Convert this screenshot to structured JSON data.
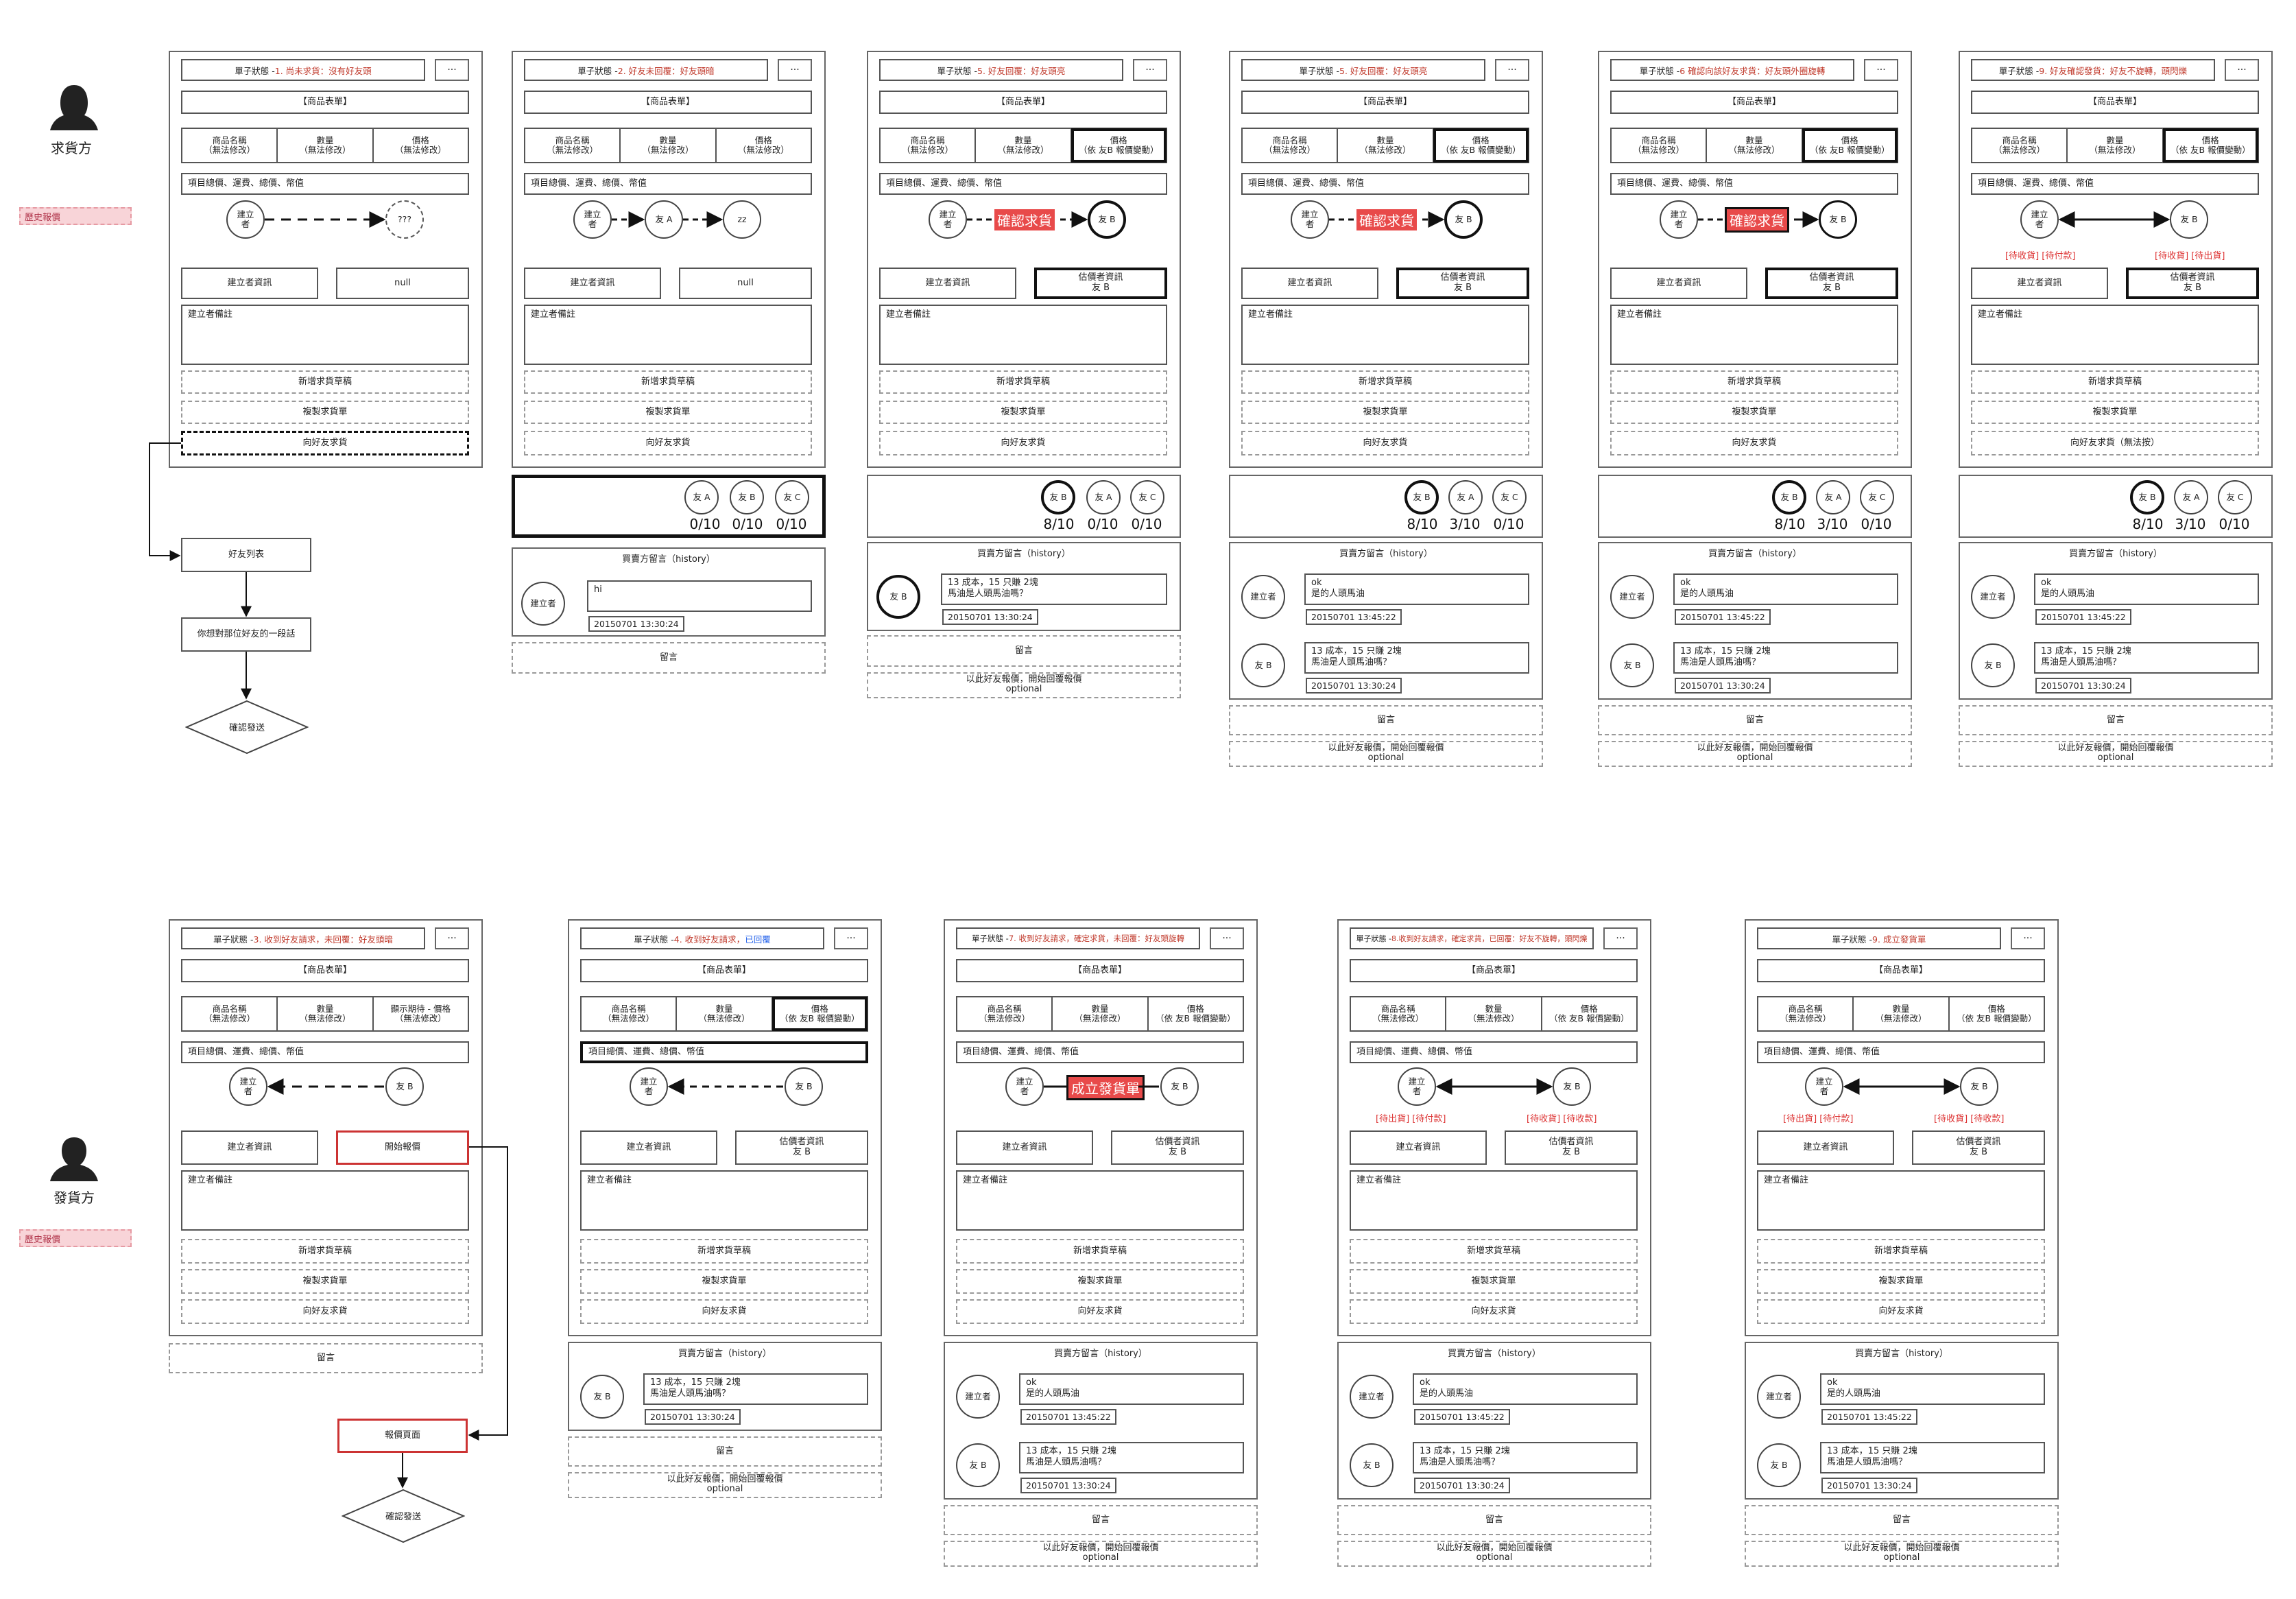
{
  "personas": {
    "requester": {
      "label": "求貨方",
      "history": "歷史報價"
    },
    "supplier": {
      "label": "發貨方",
      "history": "歷史報價"
    }
  },
  "common": {
    "status_prefix": "單子狀態 - ",
    "more": "···",
    "product_form": "【商品表單】",
    "product_name": "商品名稱\n（無法修改）",
    "quantity": "數量\n（無法修改）",
    "price_fixed": "價格\n（無法修改）",
    "price_by_b": "價格\n（依 友B 報價變動）",
    "price_expect": "顯示期待 - 價格\n（無法修改）",
    "items_total": "項目總價、運費、總價、幣值",
    "creator_short": "建立\n者",
    "creator": "建立者",
    "friend_a": "友 A",
    "friend_b": "友 B",
    "friend_c": "友 C",
    "unknown": "???",
    "zz": "zz",
    "creator_info": "建立者資訊",
    "null": "null",
    "estimator_info": "估價者資訊\n友 B",
    "creator_note": "建立者備註",
    "new_draft": "新增求貨草稿",
    "copy_order": "複製求貨單",
    "ask_friend": "向好友求貨",
    "ask_friend_disabled": "向好友求貨（無法按）",
    "start_quote": "開始報價",
    "comment": "留言",
    "history_title": "買賣方留言（history）",
    "reply_base": "以此好友報價，開始回覆報價",
    "optional": "optional",
    "confirm_request": "確認求貨",
    "establish_order": "成立發貨單",
    "pending_receipt": "[待收貨] [待付款]",
    "pending_receipt_r": "[待收貨] [待出貨]",
    "pending_ship": "[待出貨] [待付款]",
    "pending_ship_r": "[待收貨] [待收款]",
    "msg_hi": "hi",
    "msg_ok": "ok\n是的人頭馬油",
    "msg_cost": "13 成本，15 只賺 2塊\n馬油是人頭馬油嗎？",
    "ts1": "20150701 13:30:24",
    "ts2": "20150701 13:45:22",
    "score_0": "0/10",
    "score_8": "8/10",
    "score_3": "3/10"
  },
  "statuses": {
    "r1": "1. 尚未求貨：沒有好友頭",
    "r2": "2. 好友未回覆：好友頭暗",
    "r3": "5. 好友回覆：好友頭亮",
    "r4": "5. 好友回覆：好友頭亮",
    "r5": "6 確認向該好友求貨：好友頭外圈旋轉",
    "r6": "9. 好友確認發貨：好友不旋轉，頭閃爍",
    "s1": "3. 收到好友請求，未回覆：好友頭暗",
    "s2a": "4. 收到好友請求，",
    "s2b": "已回覆",
    "s3": "7. 收到好友請求，確定求貨，未回覆：好友頭旋轉",
    "s4": "8.收到好友請求，確定求貨，已回覆：好友不旋轉，頭閃爍",
    "s5": "9. 成立發貨單"
  },
  "flow": {
    "friend_list": "好友列表",
    "say_something": "你想對那位好友的一段話",
    "confirm_send": "確認發送",
    "quote_page": "報價頁面",
    "confirm_send2": "確認發送"
  },
  "colors": {
    "accent_red": "#e84a4a",
    "status_red": "#c0392b",
    "status_blue": "#2563eb",
    "history_tag": "#f8d4d8"
  }
}
